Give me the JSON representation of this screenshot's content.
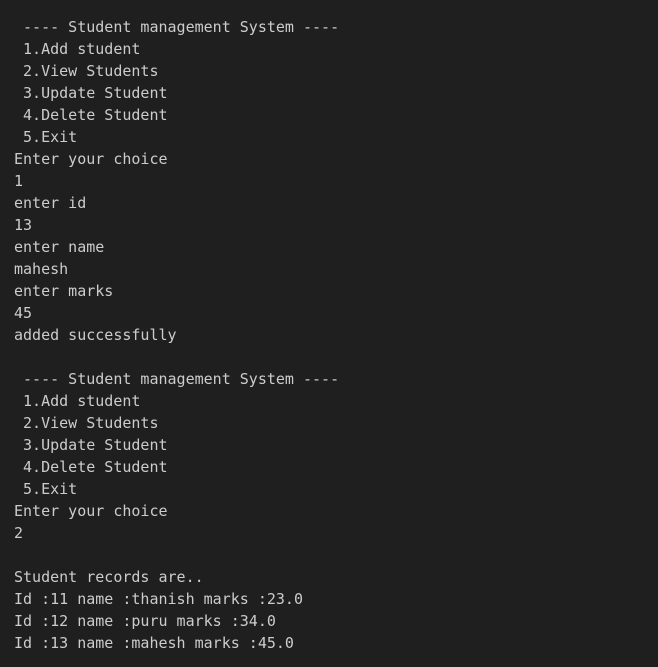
{
  "terminal": {
    "lines": [
      " ---- Student management System ----",
      " 1.Add student",
      " 2.View Students",
      " 3.Update Student",
      " 4.Delete Student",
      " 5.Exit",
      "Enter your choice",
      "1",
      "enter id",
      "13",
      "enter name",
      "mahesh",
      "enter marks",
      "45",
      "added successfully",
      "",
      " ---- Student management System ----",
      " 1.Add student",
      " 2.View Students",
      " 3.Update Student",
      " 4.Delete Student",
      " 5.Exit",
      "Enter your choice",
      "2",
      "",
      "Student records are..",
      "Id :11 name :thanish marks :23.0",
      "Id :12 name :puru marks :34.0",
      "Id :13 name :mahesh marks :45.0"
    ]
  }
}
